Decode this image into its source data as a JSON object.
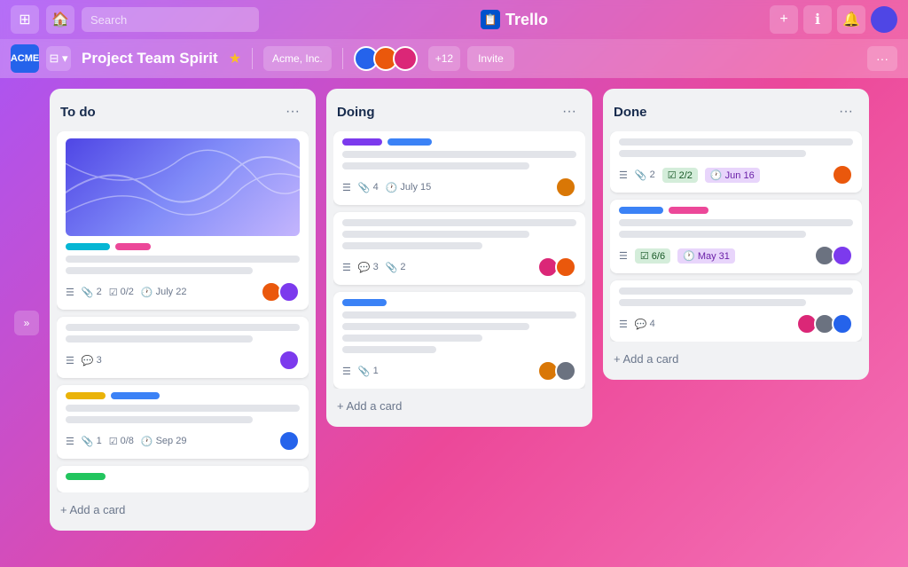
{
  "app": {
    "name": "Trello",
    "logo_text": "Trello"
  },
  "topnav": {
    "search_placeholder": "Search",
    "add_label": "+",
    "info_label": "ℹ",
    "bell_label": "🔔"
  },
  "boardnav": {
    "workspace_logo": "ACME",
    "board_name": "Project Team Spirit",
    "workspace_name": "Acme, Inc.",
    "more_members_count": "+12",
    "invite_label": "Invite",
    "more_label": "···",
    "collapse_icon": "»"
  },
  "lists": [
    {
      "id": "todo",
      "title": "To do",
      "cards": [
        {
          "type": "cover_card",
          "has_cover": true,
          "tags": [
            "cyan",
            "pink"
          ],
          "lines": [
            "full",
            "medium",
            "short"
          ],
          "meta": {
            "hamburger": true,
            "attach": "2",
            "checklist": "0/2",
            "date": "July 22"
          },
          "avatars": [
            "orange",
            "purple"
          ]
        },
        {
          "type": "text_card",
          "lines": [
            "full",
            "medium"
          ],
          "meta": {
            "hamburger": true,
            "comment": "3"
          },
          "avatars": [
            "purple"
          ]
        },
        {
          "type": "text_card",
          "lines": [
            "full",
            "medium",
            "short"
          ],
          "tags_bottom": [
            "yellow",
            "blue"
          ],
          "meta": {
            "hamburger": true,
            "attach": "1",
            "checklist": "0/8",
            "date": "Sep 29"
          },
          "avatars": [
            "blue"
          ]
        },
        {
          "type": "tag_only",
          "tags": [
            "green"
          ]
        }
      ],
      "add_label": "+ Add a card"
    },
    {
      "id": "doing",
      "title": "Doing",
      "cards": [
        {
          "type": "tag_card",
          "tags": [
            "purple",
            "blue"
          ],
          "lines": [
            "full",
            "medium"
          ],
          "meta": {
            "hamburger": true,
            "attach": "4",
            "date": "July 15"
          },
          "avatars": [
            "yellow"
          ]
        },
        {
          "type": "text_card",
          "lines": [
            "full",
            "medium",
            "short"
          ],
          "meta": {
            "hamburger": true,
            "comment": "3",
            "attach": "2"
          },
          "avatars": [
            "pink",
            "orange"
          ]
        },
        {
          "type": "tag_card2",
          "tags": [
            "blue"
          ],
          "lines": [
            "full",
            "medium",
            "short",
            "xshort"
          ],
          "meta": {
            "hamburger": true,
            "attach": "1"
          },
          "avatars": [
            "yellow",
            "gray"
          ]
        }
      ],
      "add_label": "+ Add a card"
    },
    {
      "id": "done",
      "title": "Done",
      "cards": [
        {
          "type": "text_card",
          "lines": [
            "full",
            "medium"
          ],
          "meta": {
            "hamburger": true,
            "attach": "2",
            "checklist": "2/2",
            "date": "Jun 16"
          },
          "avatars": [
            "orange"
          ]
        },
        {
          "type": "tag_card",
          "tags": [
            "blue",
            "pink"
          ],
          "lines": [
            "full",
            "medium"
          ],
          "meta": {
            "hamburger": true,
            "checklist": "6/6",
            "date": "May 31"
          },
          "avatars": [
            "gray",
            "purple"
          ]
        },
        {
          "type": "text_card",
          "lines": [
            "full",
            "medium"
          ],
          "meta": {
            "hamburger": true,
            "comment": "4"
          },
          "avatars": [
            "pink",
            "gray",
            "blue"
          ]
        }
      ],
      "add_label": "+ Add a card"
    }
  ]
}
